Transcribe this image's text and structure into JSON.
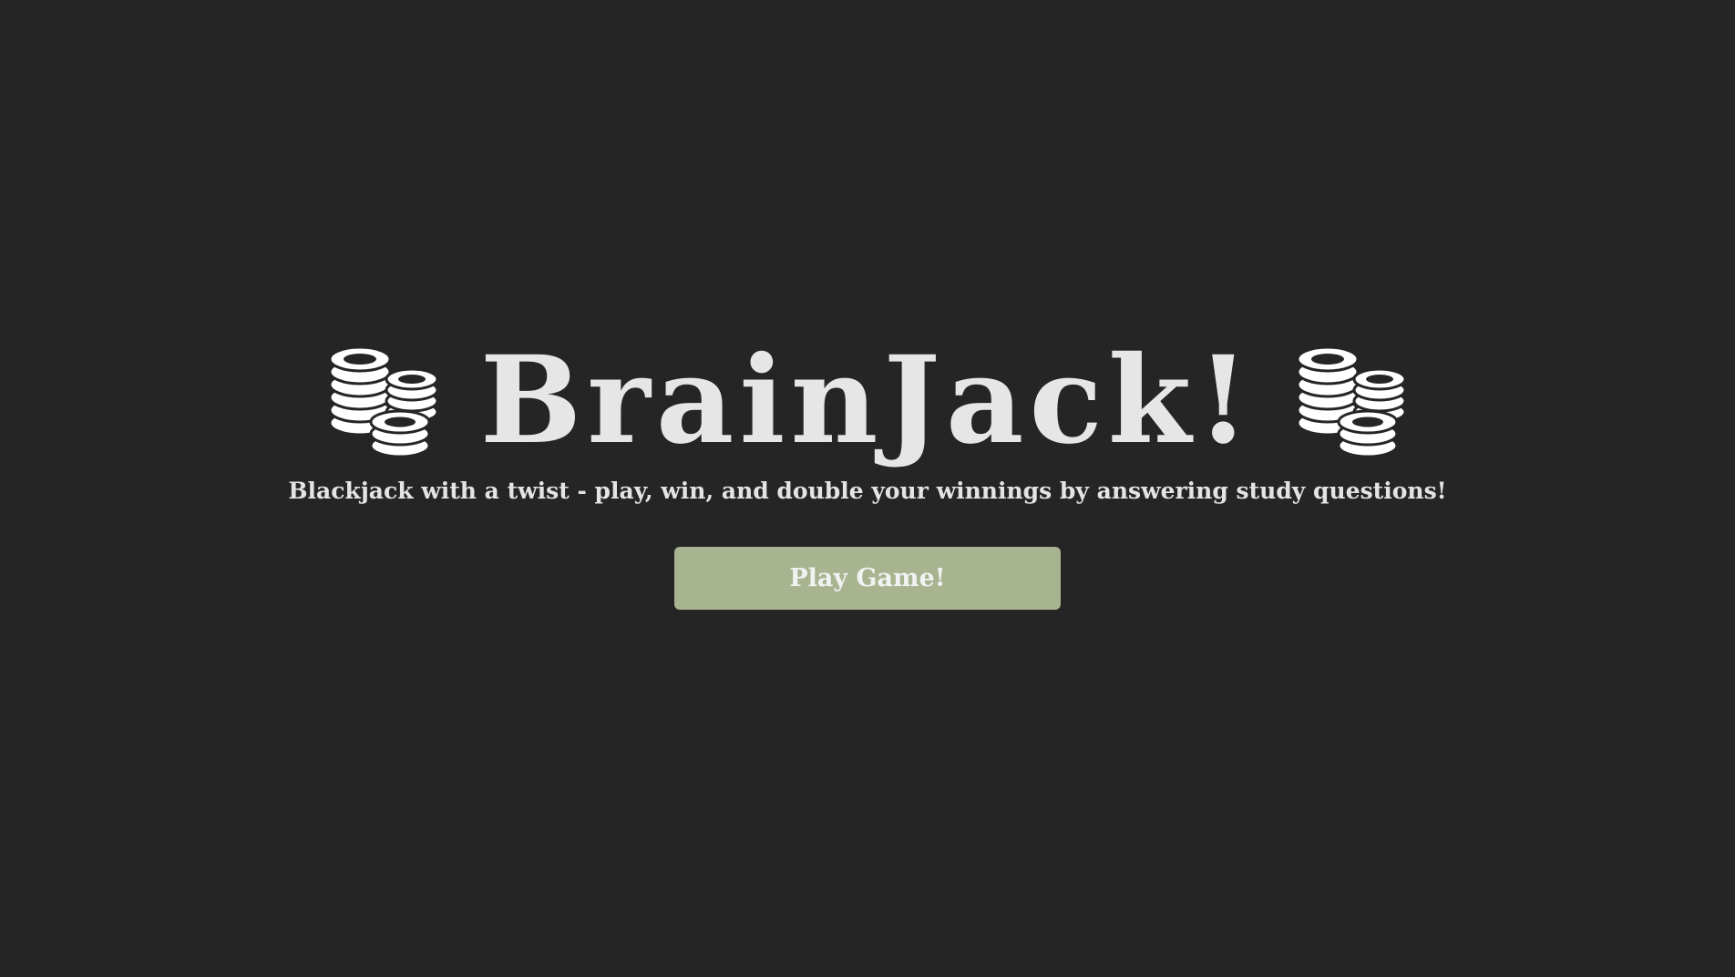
{
  "title": {
    "text": "BrainJack!",
    "left_icon": "coin-stacks-icon",
    "right_icon": "coin-stacks-icon"
  },
  "subtitle": "Blackjack with a twist - play, win, and double your winnings by answering study questions!",
  "play_button": {
    "label": "Play Game!"
  },
  "colors": {
    "background": "#252525",
    "text": "#e6e6e6",
    "button_background": "#a8b48f",
    "button_text": "#f2f2f2"
  }
}
